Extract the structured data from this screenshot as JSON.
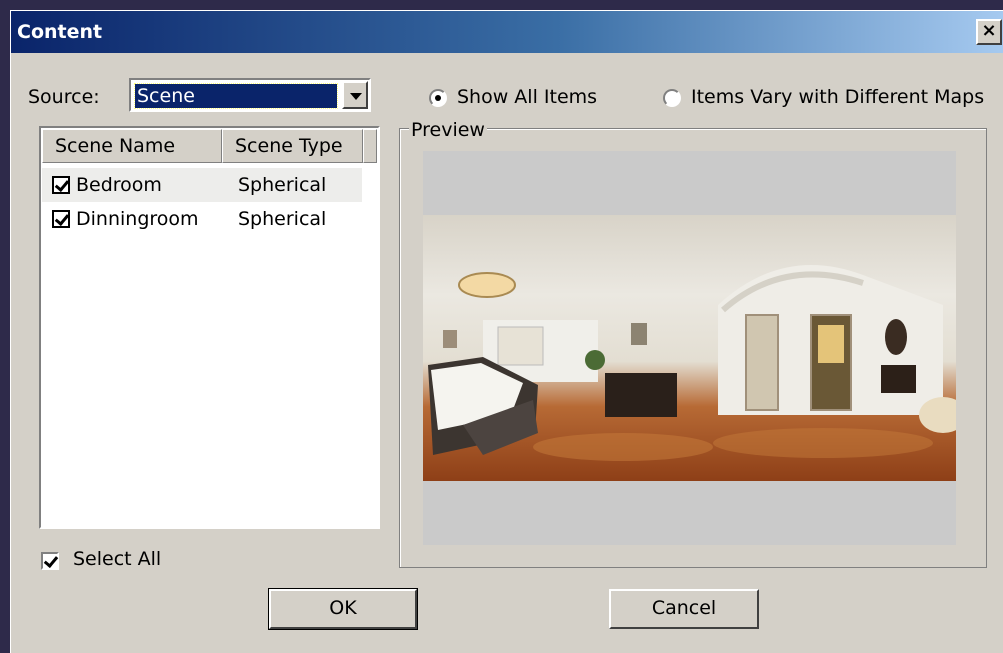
{
  "dialog": {
    "title": "Content",
    "close_label": "×"
  },
  "source": {
    "label": "Source:",
    "value": "Scene"
  },
  "options": {
    "show_all": {
      "label": "Show All Items",
      "checked": true
    },
    "vary_maps": {
      "label": "Items Vary with Different Maps",
      "checked": false
    }
  },
  "list": {
    "columns": [
      "Scene Name",
      "Scene Type"
    ],
    "rows": [
      {
        "name": "Bedroom",
        "type": "Spherical",
        "checked": true,
        "selected": true
      },
      {
        "name": "Dinningroom",
        "type": "Spherical",
        "checked": true,
        "selected": false
      }
    ]
  },
  "select_all": {
    "label": "Select All",
    "checked": true
  },
  "preview": {
    "legend": "Preview"
  },
  "buttons": {
    "ok": "OK",
    "cancel": "Cancel"
  },
  "colors": {
    "titlebar_start": "#0a246a",
    "titlebar_end": "#a6caf0",
    "dialog_bg": "#d4d0c8",
    "selection": "#0a246a"
  }
}
